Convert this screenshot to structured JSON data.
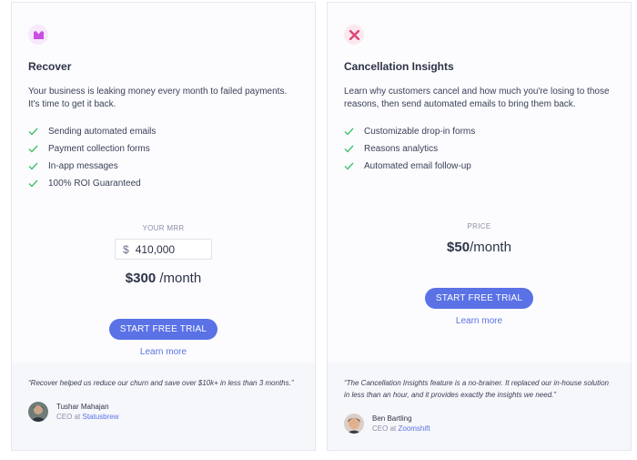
{
  "cards": [
    {
      "icon": "recover-logo-icon",
      "title": "Recover",
      "description": "Your business is leaking money every month to failed payments. It's time to get it back.",
      "features": [
        "Sending automated emails",
        "Payment collection forms",
        "In-app messages",
        "100% ROI Guaranteed"
      ],
      "input_label": "YOUR MRR",
      "currency_symbol": "$",
      "input_value": "410,000",
      "price": "$300",
      "price_unit": " /month",
      "cta_label": "START FREE TRIAL",
      "learn_more_label": "Learn more",
      "quote": "“Recover helped us reduce our churn and save over $10k+ in less than 3 months.”",
      "author_name": "Tushar Mahajan",
      "author_title": "CEO",
      "author_at": "at",
      "author_company": "Statusbrew"
    },
    {
      "icon": "cancellation-logo-icon",
      "title": "Cancellation Insights",
      "description": "Learn why customers cancel and how much you're losing to those reasons, then send automated emails to bring them back.",
      "features": [
        "Customizable drop-in forms",
        "Reasons analytics",
        "Automated email follow-up"
      ],
      "price_label": "PRICE",
      "price": "$50",
      "price_unit": "/month",
      "cta_label": "START FREE TRIAL",
      "learn_more_label": "Learn more",
      "quote": "“The Cancellation Insights feature is a no-brainer. It replaced our in-house solution in less than an hour, and it provides exactly the insights we need.”",
      "author_name": "Ben Bartling",
      "author_title": "CEO",
      "author_at": "at",
      "author_company": "Zoomshift"
    }
  ],
  "colors": {
    "accent": "#5a72e6",
    "check": "#3bbf6a",
    "recover_logo": "#c94fe0",
    "cancel_logo": "#e0457a"
  }
}
